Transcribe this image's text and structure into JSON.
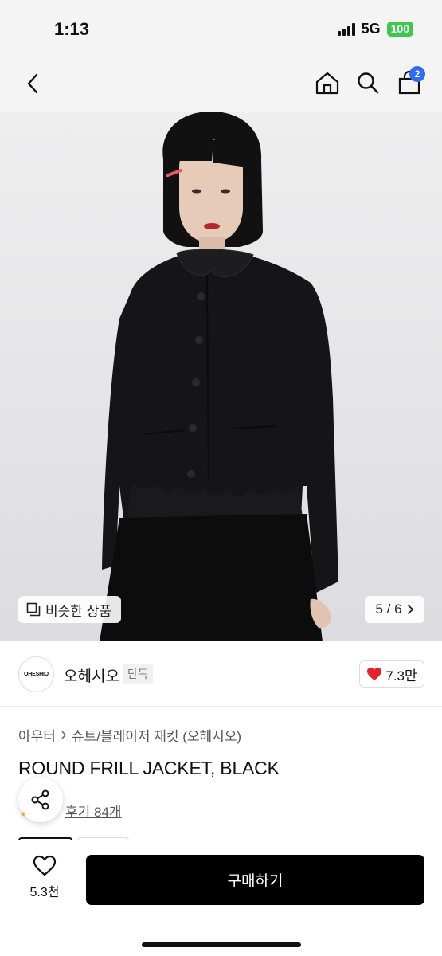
{
  "status_bar": {
    "time": "1:13",
    "network": "5G",
    "battery": "100"
  },
  "nav": {
    "cart_count": "2"
  },
  "image": {
    "similar_label": "비슷한 상품",
    "page_indicator": "5 / 6"
  },
  "brand": {
    "logo_text": "OHESHIO",
    "name": "오헤시오",
    "tag": "단독",
    "likes": "7.3만"
  },
  "product": {
    "breadcrumb": [
      "아우터",
      "슈트/블레이저 재킷 (오헤시오)"
    ],
    "title": "ROUND FRILL JACKET, BLACK",
    "reviews": "후기 84개"
  },
  "bottom": {
    "wish_count": "5.3천",
    "buy_label": "구매하기"
  },
  "colors": {
    "accent_badge": "#2f6cf5",
    "heart": "#e8202a",
    "buy_button": "#000000",
    "battery": "#3ec74f"
  }
}
